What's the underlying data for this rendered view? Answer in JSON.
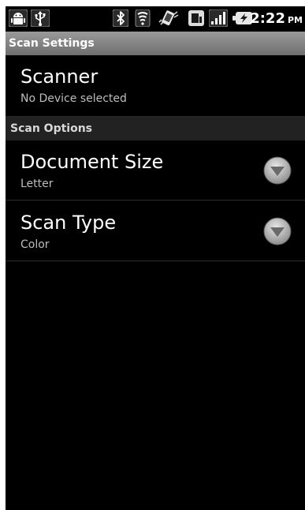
{
  "status_bar": {
    "time": "2:22",
    "ampm": "PM",
    "icons": [
      "android-debug-icon",
      "usb-icon",
      "bluetooth-icon",
      "wifi-icon",
      "vibrate-icon",
      "sim-icon",
      "signal-icon",
      "battery-charging-icon"
    ]
  },
  "title_bar": {
    "title": "Scan Settings"
  },
  "scanner": {
    "title": "Scanner",
    "summary": "No Device selected"
  },
  "scan_options": {
    "header": "Scan Options",
    "items": [
      {
        "title": "Document Size",
        "summary": "Letter"
      },
      {
        "title": "Scan Type",
        "summary": "Color"
      }
    ]
  },
  "colors": {
    "background": "#000000",
    "title_bar": "#808080",
    "category_header": "#222222",
    "summary_text": "#bdbdbd"
  }
}
